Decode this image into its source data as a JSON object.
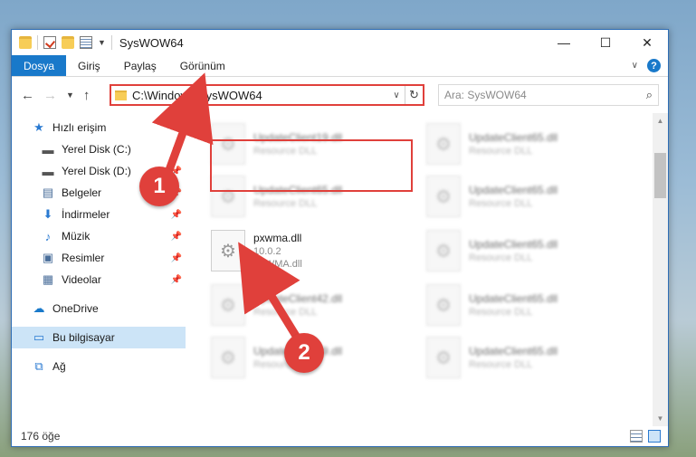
{
  "window": {
    "title": "SysWOW64",
    "controls": {
      "minimize": "—",
      "maximize": "☐",
      "close": "✕"
    }
  },
  "ribbon": {
    "file_tab": "Dosya",
    "tabs": [
      "Giriş",
      "Paylaş",
      "Görünüm"
    ],
    "help": "?"
  },
  "address": {
    "path": "C:\\Windows\\SysWOW64",
    "search_placeholder": "Ara: SysWOW64"
  },
  "sidebar": {
    "quick_access": "Hızlı erişim",
    "items": [
      {
        "label": "Yerel Disk (C:)",
        "icon": "drive-icon"
      },
      {
        "label": "Yerel Disk (D:)",
        "icon": "drive-icon"
      },
      {
        "label": "Belgeler",
        "icon": "documents-icon"
      },
      {
        "label": "İndirmeler",
        "icon": "downloads-icon"
      },
      {
        "label": "Müzik",
        "icon": "music-icon"
      },
      {
        "label": "Resimler",
        "icon": "pictures-icon"
      },
      {
        "label": "Videolar",
        "icon": "videos-icon"
      }
    ],
    "onedrive": "OneDrive",
    "this_pc": "Bu bilgisayar",
    "network": "Ağ"
  },
  "files": {
    "column1": [
      {
        "name": "UpdateClient19.dll",
        "sub": "Resource DLL"
      },
      {
        "name": "UpdateClient65.dll",
        "sub": "Resource DLL"
      },
      {
        "name": "pxwma.dll",
        "version": "10.0.2",
        "sub": "PxWMA.dll"
      },
      {
        "name": "UpdateClient42.dll",
        "sub": "Resource DLL"
      },
      {
        "name": "UpdateClient19.dll",
        "sub": "Resource DLL"
      }
    ],
    "column2": [
      {
        "name": "UpdateClient65.dll",
        "sub": "Resource DLL"
      },
      {
        "name": "UpdateClient65.dll",
        "sub": "Resource DLL"
      },
      {
        "name": "UpdateClient65.dll",
        "sub": "Resource DLL"
      },
      {
        "name": "UpdateClient65.dll",
        "sub": "Resource DLL"
      },
      {
        "name": "UpdateClient65.dll",
        "sub": "Resource DLL"
      }
    ]
  },
  "status": {
    "count": "176 öğe"
  },
  "annotations": {
    "step1": "1",
    "step2": "2",
    "color": "#e0403b"
  }
}
